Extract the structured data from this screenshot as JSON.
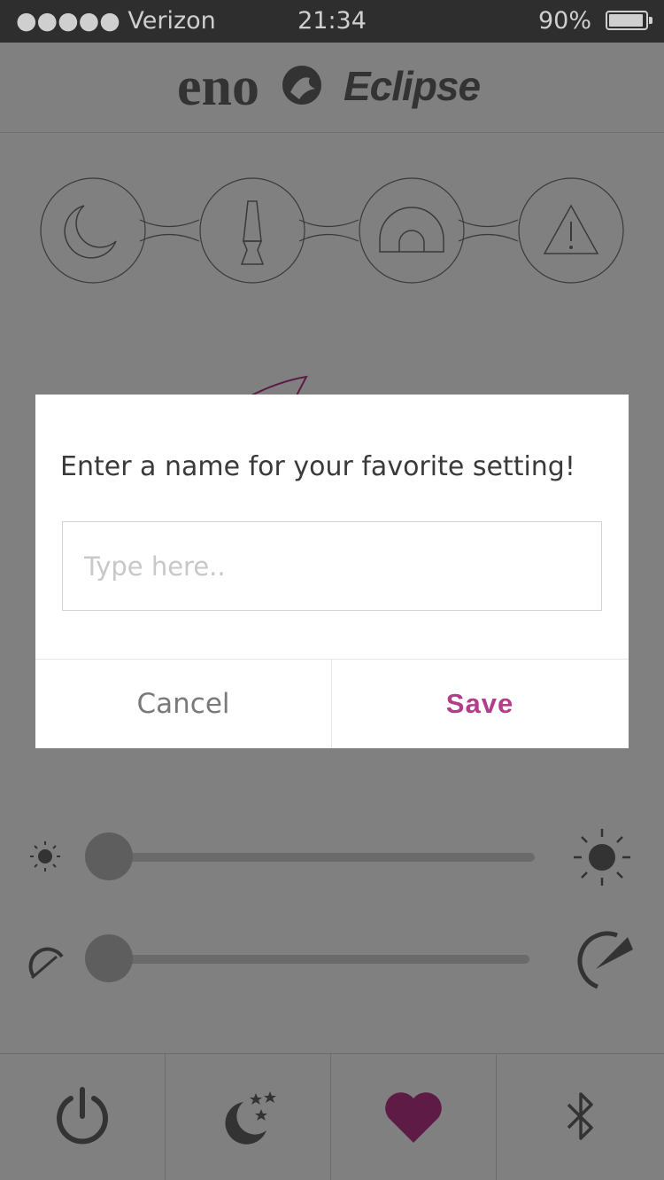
{
  "status_bar": {
    "carrier": "●●●●● Verizon",
    "time": "21:34",
    "battery": "90%"
  },
  "header": {
    "brand": "eno",
    "title": "Eclipse"
  },
  "modes": [
    {
      "icon": "moon-icon"
    },
    {
      "icon": "lava-lamp-icon"
    },
    {
      "icon": "rainbow-arch-icon"
    },
    {
      "icon": "warning-icon"
    }
  ],
  "sliders": {
    "brightness": {
      "level": 0
    },
    "speed": {
      "level": 0
    }
  },
  "dialog": {
    "prompt": "Enter a name for your favorite setting!",
    "input_placeholder": "Type here..",
    "input_value": "",
    "cancel_label": "Cancel",
    "save_label": "Save"
  },
  "tabbar": [
    {
      "icon": "power-icon"
    },
    {
      "icon": "moon-stars-icon"
    },
    {
      "icon": "heart-icon",
      "active": true
    },
    {
      "icon": "bluetooth-icon"
    }
  ],
  "colors": {
    "accent": "#b23e8a",
    "heart_active": "#5e1b46",
    "overlay": "#808080"
  }
}
